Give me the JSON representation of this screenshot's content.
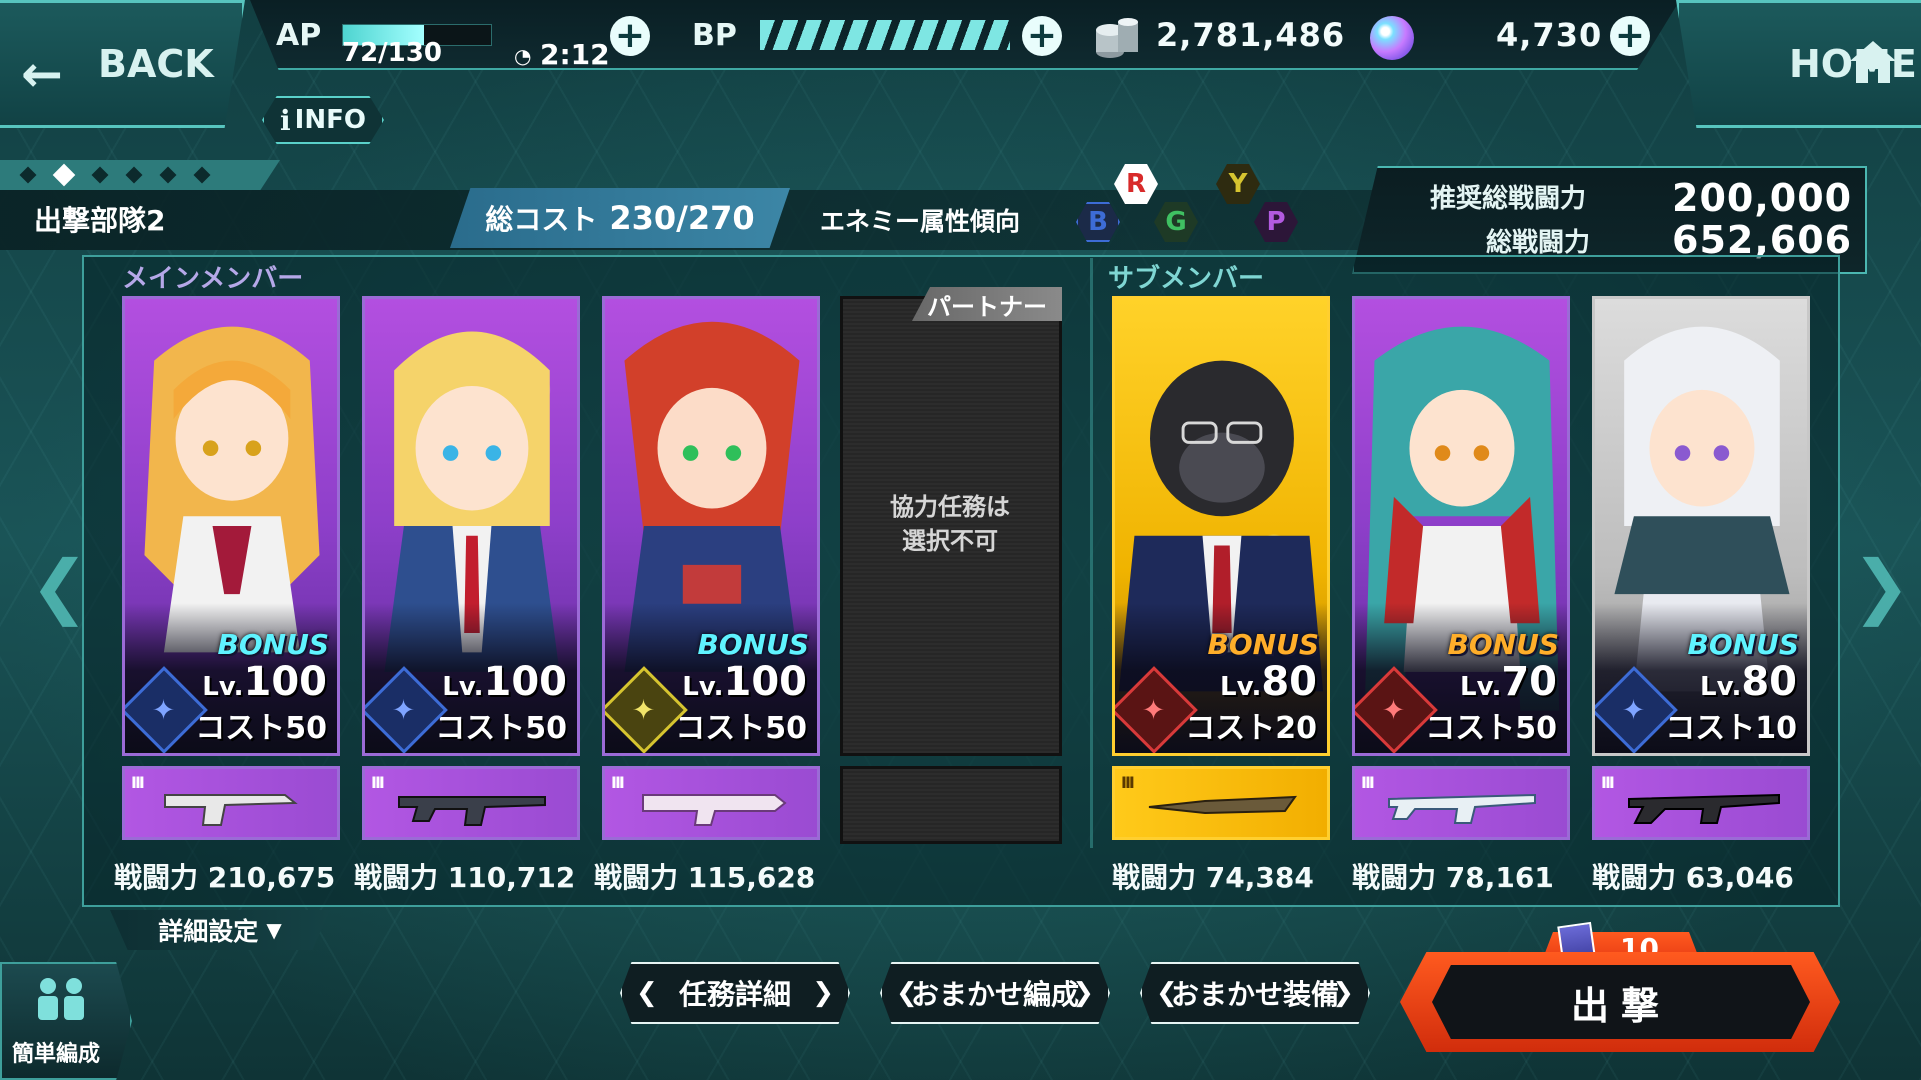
{
  "nav": {
    "back_label": "BACK",
    "home_label": "HOME",
    "info_label": "INFO"
  },
  "status": {
    "ap_label": "AP",
    "ap_value": "72/130",
    "ap_fraction": 0.55,
    "ap_timer": "2:12",
    "bp_label": "BP",
    "bp_fraction": 1.0,
    "coins": "2,781,486",
    "gems": "4,730"
  },
  "team": {
    "name": "出撃部隊2",
    "page_count": 6,
    "active_page": 2,
    "cost_label": "総コスト",
    "cost_value": "230/270",
    "enemy_label": "エネミー属性傾向",
    "attributes": [
      "R",
      "B",
      "G",
      "Y",
      "P"
    ]
  },
  "power": {
    "recommended_label": "推奨総戦闘力",
    "recommended_value": "200,000",
    "total_label": "総戦闘力",
    "total_value": "652,606"
  },
  "sections": {
    "main": "メインメンバー",
    "sub": "サブメンバー"
  },
  "partner": {
    "tag": "パートナー",
    "text_line1": "協力任務は",
    "text_line2": "選択不可"
  },
  "members": [
    {
      "bonus": "BONUS",
      "lv_prefix": "Lv.",
      "level": "100",
      "cost": "コスト50",
      "power": "戦闘力 210,675",
      "weapon_bars": "III"
    },
    {
      "bonus": "",
      "lv_prefix": "Lv.",
      "level": "100",
      "cost": "コスト50",
      "power": "戦闘力 110,712",
      "weapon_bars": "III"
    },
    {
      "bonus": "BONUS",
      "lv_prefix": "Lv.",
      "level": "100",
      "cost": "コスト50",
      "power": "戦闘力 115,628",
      "weapon_bars": "III"
    },
    {
      "bonus": "BONUS",
      "lv_prefix": "Lv.",
      "level": "80",
      "cost": "コスト20",
      "power": "戦闘力 74,384",
      "weapon_bars": "III"
    },
    {
      "bonus": "BONUS",
      "lv_prefix": "Lv.",
      "level": "70",
      "cost": "コスト50",
      "power": "戦闘力 78,161",
      "weapon_bars": "III"
    },
    {
      "bonus": "BONUS",
      "lv_prefix": "Lv.",
      "level": "80",
      "cost": "コスト10",
      "power": "戦闘力 63,046",
      "weapon_bars": "III"
    }
  ],
  "controls": {
    "detail_settings": "詳細設定",
    "easy_team": "簡単編成",
    "mission_detail": "任務詳細",
    "auto_team": "おまかせ編成",
    "auto_equip": "おまかせ装備",
    "sortie": "出撃",
    "ticket_count": "10"
  },
  "colors": {
    "accent": "#57c5bf",
    "rare_purple": "#9b6bd6",
    "rare_gold": "#ffcf2f",
    "sortie": "#ff5a1f",
    "bonus_cyan": "#5ff3ff",
    "bonus_orange": "#ffae2a"
  }
}
